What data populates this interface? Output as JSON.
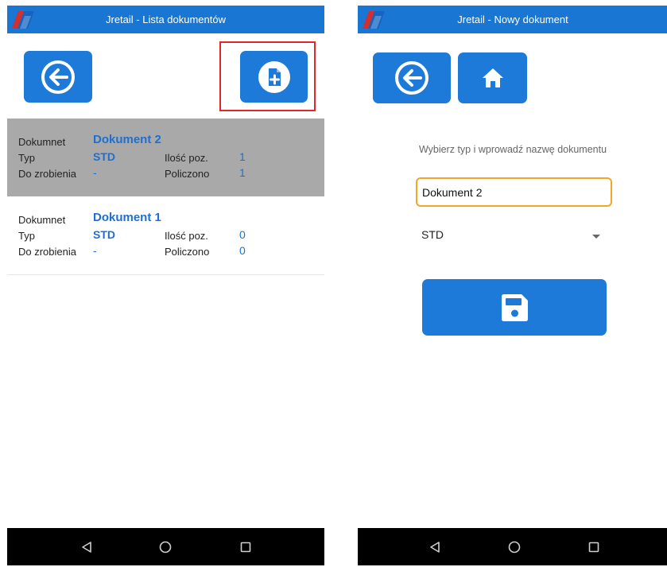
{
  "left_screen": {
    "title": "Jretail - Lista dokumentów",
    "documents": [
      {
        "label_dokument": "Dokumnet",
        "name": "Dokument 2",
        "label_typ": "Typ",
        "typ": "STD",
        "label_ilosc": "Ilość poz.",
        "ilosc": "1",
        "label_do_zrobienia": "Do zrobienia",
        "do_zrobienia": "-",
        "label_policzono": "Policzono",
        "policzono": "1",
        "selected": true
      },
      {
        "label_dokument": "Dokumnet",
        "name": "Dokument 1",
        "label_typ": "Typ",
        "typ": "STD",
        "label_ilosc": "Ilość poz.",
        "ilosc": "0",
        "label_do_zrobienia": "Do zrobienia",
        "do_zrobienia": "-",
        "label_policzono": "Policzono",
        "policzono": "0",
        "selected": false
      }
    ]
  },
  "right_screen": {
    "title": "Jretail - Nowy dokument",
    "hint": "Wybierz typ i wprowadź nazwę dokumentu",
    "name_value": "Dokument 2",
    "type_value": "STD"
  },
  "icons": {
    "back": "arrow-left-circle-icon",
    "add_document": "document-plus-icon",
    "home": "home-icon",
    "save": "floppy-disk-icon",
    "nav_back": "triangle-back-icon",
    "nav_home": "circle-home-icon",
    "nav_recents": "square-recents-icon"
  },
  "colors": {
    "appbar": "#1976d2",
    "button": "#1e7ad9",
    "accent_text": "#1e6fd0",
    "input_focus": "#f5a623",
    "highlight": "#e02828",
    "selected_row": "#a9a9a9"
  }
}
